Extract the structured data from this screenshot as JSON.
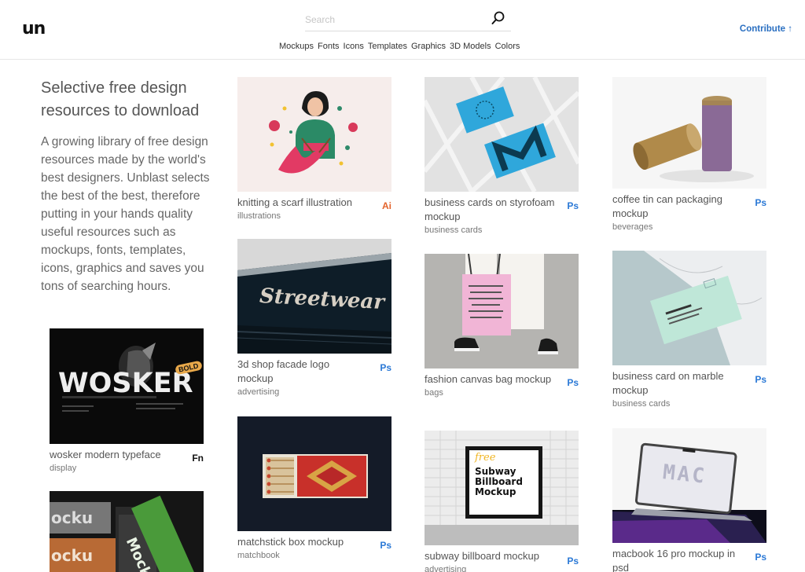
{
  "header": {
    "logo": "un",
    "search_placeholder": "Search",
    "categories": [
      "Mockups",
      "Fonts",
      "Icons",
      "Templates",
      "Graphics",
      "3D Models",
      "Colors"
    ],
    "contribute_label": "Contribute ↑"
  },
  "intro": {
    "title": "Selective free design resources to download",
    "text": "A growing library of free design resources made by the world's best designers. Unblast selects the best of the best, therefore putting in your hands quality useful resources such as mockups, fonts, templates, icons, graphics and saves you tons of searching hours."
  },
  "colors": {
    "accent": "#2a6fc1",
    "ps_badge": "#2b79d6",
    "ai_badge": "#e3642c"
  },
  "cards": {
    "wosker": {
      "title": "wosker modern typeface",
      "category": "display",
      "badge": "Fn",
      "image_text": "WOSKER",
      "image_tag": "BOLD"
    },
    "mocku": {
      "image_text_1": "ocku",
      "image_text_2": "Mock",
      "image_text_3": "ocku"
    },
    "scarf": {
      "title": "knitting a scarf illustration",
      "category": "illustrations",
      "badge": "Ai"
    },
    "facade": {
      "title": "3d shop facade logo mockup",
      "category": "advertising",
      "badge": "Ps",
      "image_text": "Streetwear"
    },
    "matchbox": {
      "title": "matchstick box mockup",
      "category": "matchbook",
      "badge": "Ps"
    },
    "bizcards": {
      "title": "business cards on styrofoam mockup",
      "category": "business cards",
      "badge": "Ps"
    },
    "tote": {
      "title": "fashion canvas bag mockup",
      "category": "bags",
      "badge": "Ps"
    },
    "billboard": {
      "title": "subway billboard mockup",
      "category": "advertising",
      "badge": "Ps",
      "image_text": "Subway Billboard Mockup",
      "image_tag": "free"
    },
    "coffee": {
      "title": "coffee tin can packaging mockup",
      "category": "beverages",
      "badge": "Ps"
    },
    "marble": {
      "title": "business card on marble mockup",
      "category": "business cards",
      "badge": "Ps"
    },
    "macbook": {
      "title": "macbook 16 pro mockup in psd",
      "badge": "Ps",
      "image_text": "MAC"
    }
  }
}
